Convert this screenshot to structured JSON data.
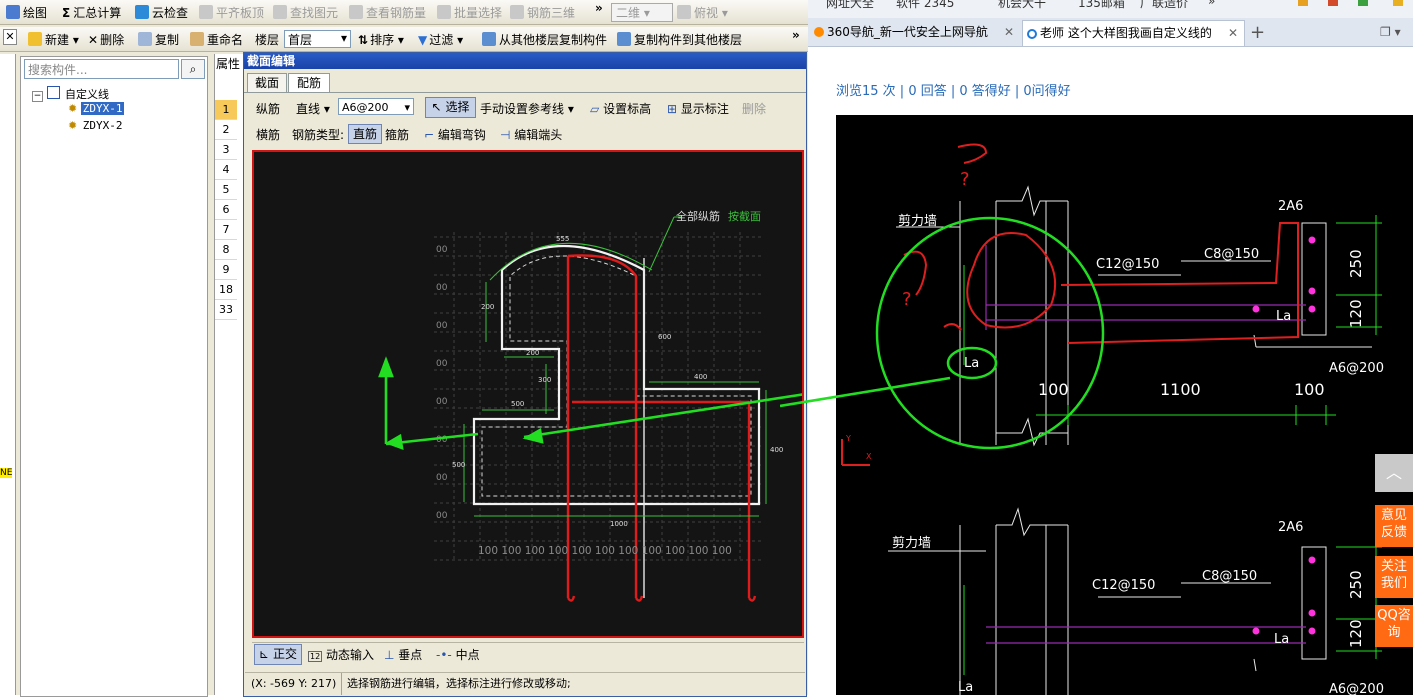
{
  "toolbar1": {
    "draw": "绘图",
    "summary": "汇总计算",
    "cloud_check": "云检查",
    "flat_slab": "平齐板顶",
    "find_element": "查找图元",
    "view_rebar": "查看钢筋量",
    "batch_select": "批量选择",
    "rebar_3d": "钢筋三维",
    "more": "»",
    "view_mode": "二维",
    "view_dir": "俯视"
  },
  "toolbar2": {
    "new": "新建",
    "delete": "删除",
    "copy": "复制",
    "rename": "重命名",
    "floor_label": "楼层",
    "floor_value": "首层",
    "sort": "排序",
    "filter": "过滤",
    "copy_from": "从其他楼层复制构件",
    "copy_to": "复制构件到其他楼层",
    "more": "»"
  },
  "tree": {
    "search_placeholder": "搜索构件...",
    "root": "自定义线",
    "items": [
      "ZDYX-1",
      "ZDYX-2"
    ]
  },
  "props_label": "属性",
  "row_numbers": [
    "1",
    "2",
    "3",
    "4",
    "5",
    "6",
    "7",
    "8",
    "9",
    "18",
    "33"
  ],
  "left_edge_text": "NE",
  "dialog": {
    "title": "截面编辑",
    "tabs": [
      "截面",
      "配筋"
    ],
    "row1": {
      "longitudinal": "纵筋",
      "line_mode": "直线",
      "spec": "A6@200",
      "select": "选择",
      "manual_ref": "手动设置参考线",
      "set_elev": "设置标高",
      "show_dim": "显示标注",
      "delete": "删除"
    },
    "row2": {
      "horizontal": "横筋",
      "rebar_type": "钢筋类型:",
      "straight": "直筋",
      "stirrup": "箍筋",
      "edit_hook": "编辑弯钩",
      "edit_end": "编辑端头"
    },
    "canvas": {
      "all_long": "全部纵筋",
      "by_section": "按截面",
      "dims": [
        "555",
        "200",
        "200",
        "600",
        "300",
        "400",
        "500",
        "400",
        "500",
        "1000"
      ],
      "bottom_dims": "100 100 100 100 100 100 100 100 100 100 100",
      "grid_label": "00"
    },
    "bottom": {
      "ortho": "正交",
      "dyn_input": "动态输入",
      "perp": "垂点",
      "mid": "中点"
    }
  },
  "status": {
    "coords": "(X: -569 Y: 217)",
    "hint": "选择钢筋进行编辑，选择标注进行修改或移动;"
  },
  "browser": {
    "top_links": [
      "网址大全",
      "软件 2345",
      "机会大干",
      "135邮箱",
      "广联造价",
      "»"
    ],
    "tabs": [
      {
        "title": "360导航_新一代安全上网导航"
      },
      {
        "title": "老师 这个大样图我画自定义线的"
      }
    ],
    "stats": "浏览15 次 | 0 回答 | 0 答得好 | 0问得好",
    "drawing": {
      "wall": "剪力墙",
      "c12": "C12@150",
      "c8": "C8@150",
      "top_bars": "2A6",
      "la": "La",
      "d250": "250",
      "d120": "120",
      "d100a": "100",
      "d1100": "1100",
      "d100b": "100",
      "a6": "A6@200",
      "q1": "?",
      "q2": "?",
      "axis_y": "Y",
      "axis_x": "X"
    },
    "side_buttons": [
      "意见反馈",
      "关注我们",
      "QQ咨询"
    ]
  },
  "colors": {
    "accent_title": "#1c47ab",
    "canvas_border": "#d21414",
    "rebar_red": "#e01b1b",
    "arrow_green": "#22dd22",
    "side_orange": "#ff6a13",
    "stats_blue": "#2a6bb8"
  }
}
